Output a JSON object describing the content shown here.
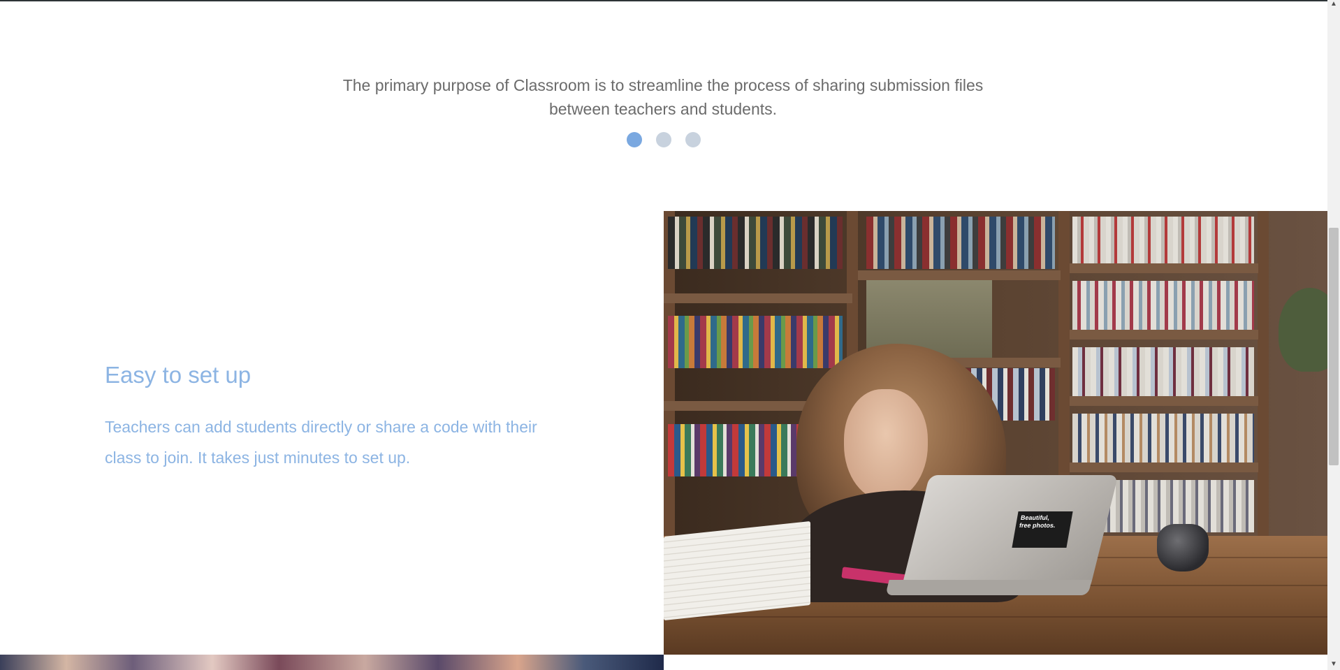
{
  "testimonial": {
    "quote": "The primary purpose of Classroom is to streamline the process of sharing submission files between teachers and students."
  },
  "carousel": {
    "slides": 3,
    "active_index": 0
  },
  "feature": {
    "title": "Easy to set up",
    "description": "Teachers can add students directly or share a code with their class to join. It takes just minutes to set up."
  },
  "photo": {
    "sticker_line1": "Beautiful,",
    "sticker_line2": "free photos."
  },
  "scrollbar": {
    "up_icon": "chevron-up-icon",
    "down_icon": "chevron-down-icon"
  },
  "colors": {
    "accent_blue": "#7aa8e0",
    "dot_inactive": "#c8d2de",
    "feature_text": "#8cb4e3",
    "body_text": "#6b6b6b"
  }
}
